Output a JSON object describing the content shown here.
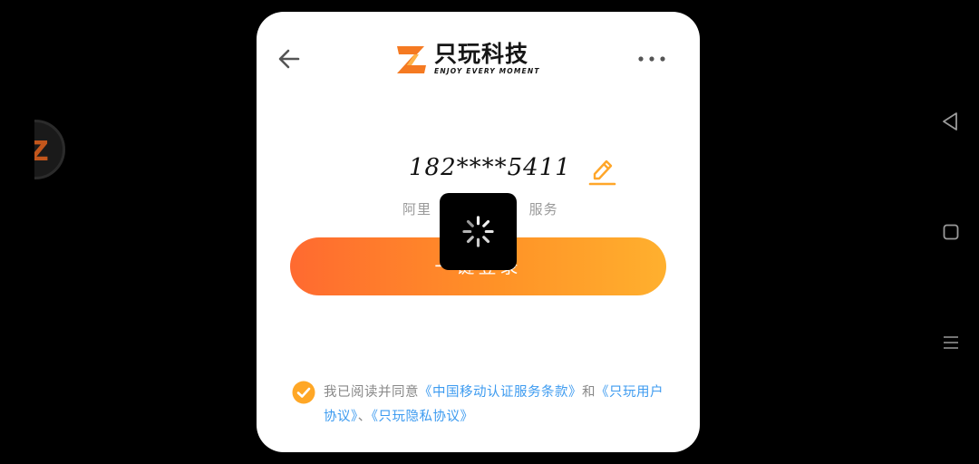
{
  "logo": {
    "title": "只玩科技",
    "subtitle": "ENJOY EVERY MOMENT",
    "mark_icon": "z-logo-icon",
    "color": "#f57a22"
  },
  "toolbar": {
    "back_icon": "arrow-left-icon",
    "more_icon": "more-horizontal-icon"
  },
  "phone": {
    "number": "182****5411",
    "edit_icon": "pencil-icon"
  },
  "service": {
    "text_left": "阿里",
    "text_right": "服务"
  },
  "login_button": {
    "label": "一键登录",
    "gradient": [
      "#ff6a30",
      "#ffb02e"
    ]
  },
  "loading": {
    "spinner_icon": "spinner-icon"
  },
  "agreement": {
    "checked": true,
    "prefix": "我已阅读并同意",
    "link1": "《中国移动认证服务条款》",
    "and": "和",
    "link2": "《只玩用户协议》",
    "sep": "、",
    "link3": "《只玩隐私协议》"
  },
  "system_nav": {
    "back_icon": "nav-back-triangle-icon",
    "home_icon": "nav-home-square-icon",
    "recents_icon": "nav-menu-lines-icon"
  },
  "colors": {
    "accent": "#ffa629",
    "link": "#3d9bf0",
    "checkbox": "#ffa726"
  }
}
